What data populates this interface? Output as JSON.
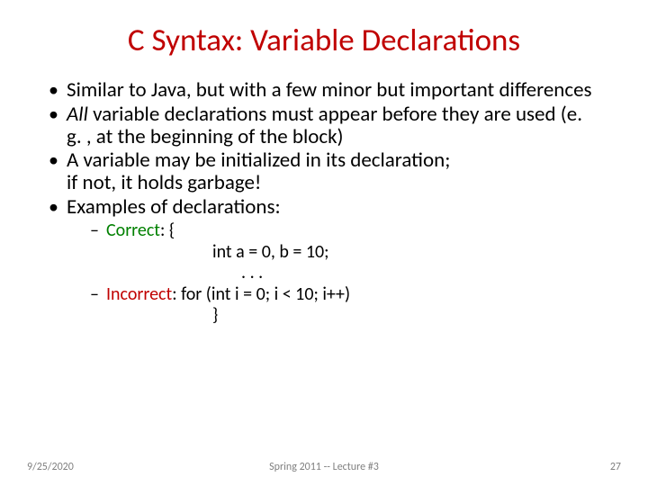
{
  "title": "C Syntax: Variable Declarations",
  "bullets": {
    "b1": "Similar to Java, but with a few minor but important differences",
    "b2_pre": "All",
    "b2_rest": " variable declarations must appear before they are used (e. g. , at the beginning of the block)",
    "b3a": "A variable may be initialized in its declaration;",
    "b3b": "if not, it holds garbage!",
    "b4": "Examples of declarations:"
  },
  "sub": {
    "dash1": "–",
    "dash2": "–",
    "correct_label": "Correct",
    "brace_open": ": {",
    "code1": "int a = 0, b = 10;",
    "code2": ". . .",
    "incorrect_label": "Incorrect",
    "colon_space": ":   ",
    "code3": "for (int i = 0; i < 10; i++)",
    "brace_close": "}"
  },
  "footer": {
    "date": "9/25/2020",
    "center": "Spring 2011 -- Lecture #3",
    "num": "27"
  }
}
